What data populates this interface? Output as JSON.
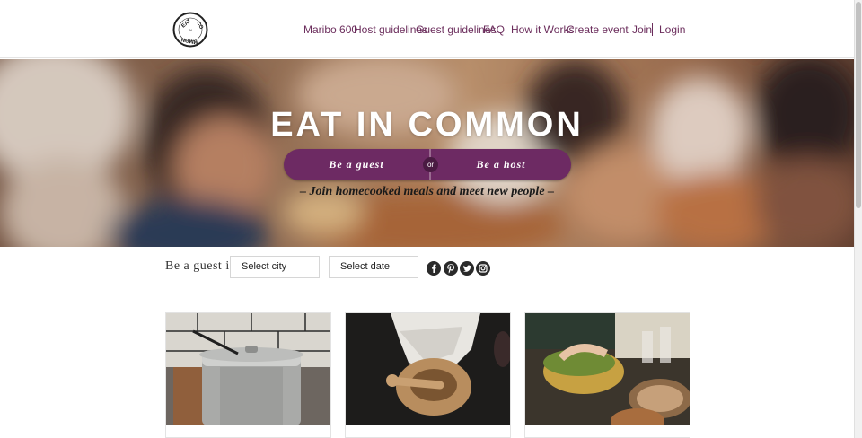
{
  "header": {
    "logo_text": "EAT IN COMMON",
    "nav": [
      {
        "label": "Maribo 600"
      },
      {
        "label": "Host guidelines"
      },
      {
        "label": "Guest guidelines"
      },
      {
        "label": "FAQ"
      },
      {
        "label": "How it Works"
      },
      {
        "label": "Create event"
      }
    ],
    "join_label": "Join",
    "login_label": "Login"
  },
  "hero": {
    "title": "EAT IN COMMON",
    "guest_button": "Be a guest",
    "or_label": "or",
    "host_button": "Be a host",
    "tagline": "– Join homecooked meals and meet new people –"
  },
  "filter": {
    "label": "Be a guest in",
    "city_select": "Select city",
    "date_select": "Select date",
    "social": [
      "facebook-icon",
      "pinterest-icon",
      "twitter-icon",
      "instagram-icon"
    ]
  },
  "cards": [
    {
      "image": "cooking-pot-photo"
    },
    {
      "image": "mortar-and-pestle-photo"
    },
    {
      "image": "dinner-table-photo"
    }
  ],
  "colors": {
    "brand": "#6d2a63",
    "nav_text": "#6b2d5c"
  }
}
